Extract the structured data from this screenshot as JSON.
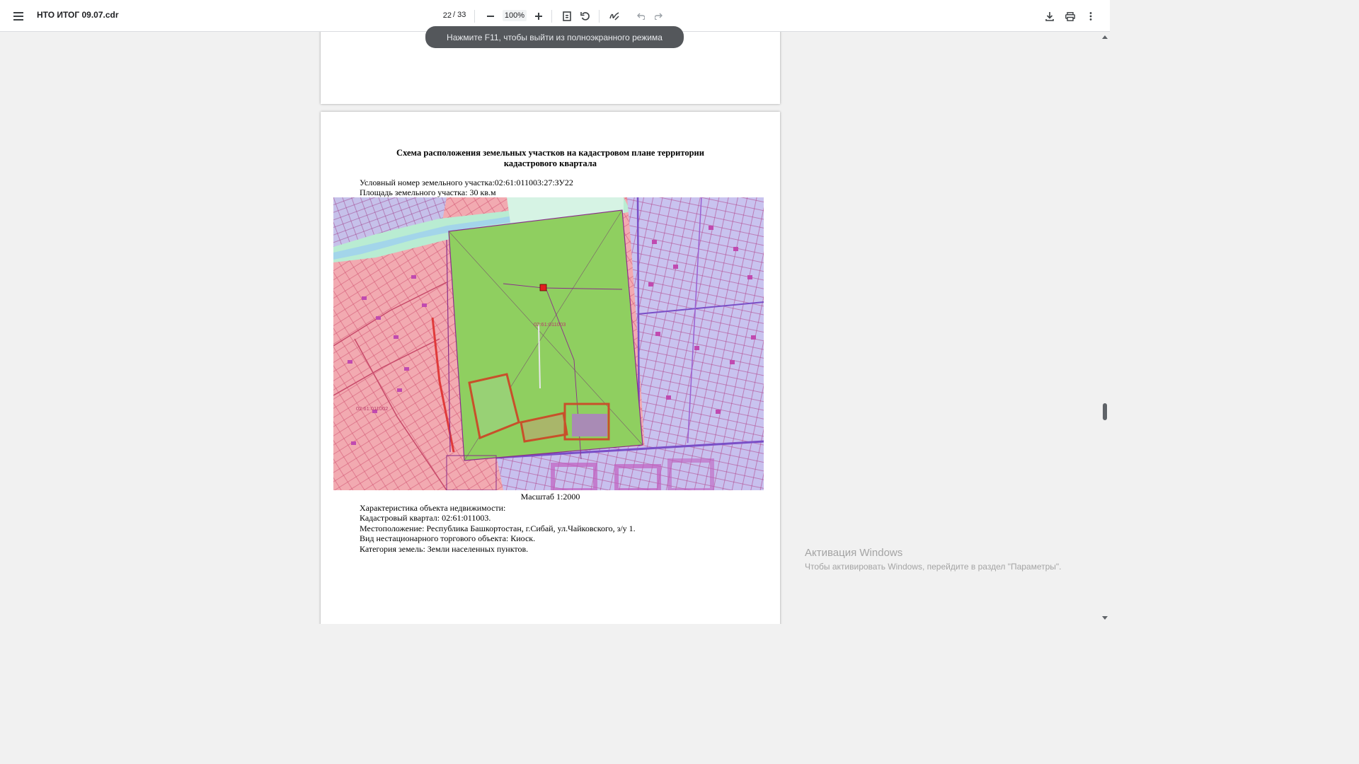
{
  "toolbar": {
    "document_title": "НТО ИТОГ 09.07.cdr",
    "current_page": "22",
    "total_pages": "/ 33",
    "zoom": "100%",
    "icons": [
      "menu-icon",
      "zoom-out-icon",
      "zoom-in-icon",
      "fit-page-icon",
      "rotate-icon",
      "annotate-icon",
      "undo-icon",
      "redo-icon",
      "download-icon",
      "print-icon",
      "more-icon"
    ]
  },
  "toast": {
    "message": "Нажмите F11, чтобы выйти из полноэкранного режима"
  },
  "page": {
    "title_line1": "Схема расположения земельных участков на кадастровом плане территории",
    "title_line2": "кадастрового квартала",
    "plot_number": "Условный номер земельного участка:02:61:011003:27:ЗУ22",
    "plot_area": "Площадь земельного участка: 30 кв.м",
    "scale": "Масштаб 1:2000",
    "characteristics_heading": "Характеристика объекта недвижимости:",
    "cadastral_quarter": "Кадастровый квартал: 02:61:011003.",
    "location": "Местоположение: Республика Башкортостан, г.Сибай, ул.Чайковского, з/у 1.",
    "object_type": "Вид нестационарного торгового объекта: Киоск.",
    "land_category": "Категория земель: Земли населенных пунктов."
  },
  "map": {
    "label_center_quarter": "02:61:011003",
    "label_west_quarter": "02:61:011002",
    "colors": {
      "residential_pink": "#f2a9b0",
      "park_green": "#8fce5f",
      "blocks_lavender": "#c9c3ef",
      "marker_red": "#e02020",
      "boundary_purple": "#8a2d8a",
      "zone_outline_orange": "#c8502a"
    }
  },
  "watermark": {
    "title": "Активация Windows",
    "subtitle": "Чтобы активировать Windows, перейдите в раздел \"Параметры\"."
  }
}
